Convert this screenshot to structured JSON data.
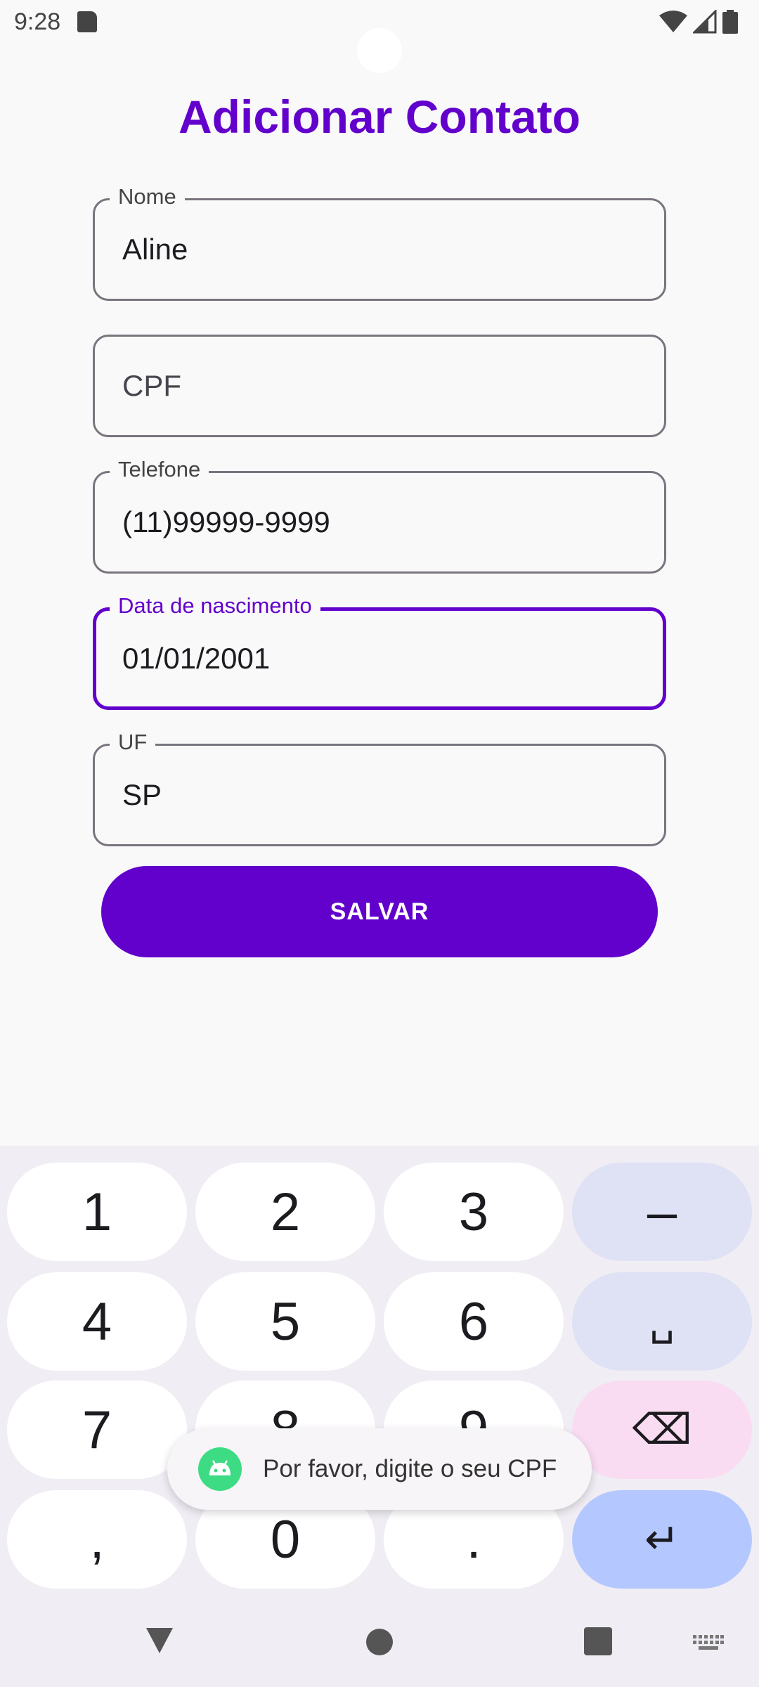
{
  "status_bar": {
    "time": "9:28"
  },
  "header": {
    "title": "Adicionar Contato"
  },
  "form": {
    "nome": {
      "label": "Nome",
      "value": "Aline"
    },
    "cpf": {
      "placeholder": "CPF"
    },
    "telefone": {
      "label": "Telefone",
      "value": "(11)99999-9999"
    },
    "nascimento": {
      "label": "Data de nascimento",
      "value": "01/01/2001"
    },
    "uf": {
      "label": "UF",
      "value": "SP"
    },
    "save_label": "SALVAR"
  },
  "keyboard": {
    "keys": [
      "1",
      "2",
      "3",
      "–",
      "4",
      "5",
      "6",
      "␣",
      "7",
      "8",
      "9",
      "⌫",
      ",",
      "0",
      ".",
      "↵"
    ]
  },
  "toast": {
    "message": "Por favor, digite o seu CPF",
    "icon": "android-icon"
  },
  "colors": {
    "accent": "#6200cc",
    "outline": "#79747e",
    "key_func": "#dfe1f5",
    "key_delete": "#fadcf2",
    "key_enter": "#b5c7ff",
    "toast_icon": "#3ddc84"
  }
}
